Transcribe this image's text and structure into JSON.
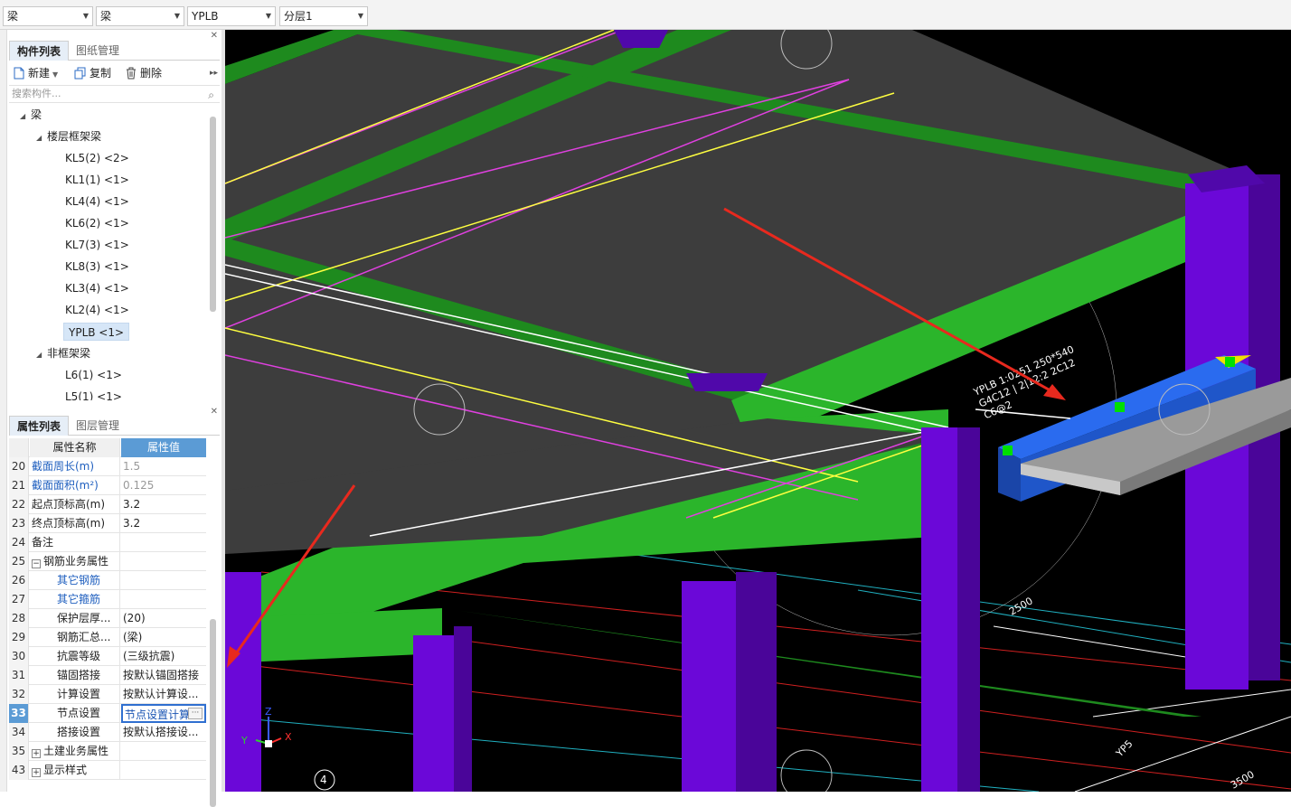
{
  "toolbar_combos": [
    {
      "value": "梁"
    },
    {
      "value": "梁"
    },
    {
      "value": "YPLB"
    },
    {
      "value": "分层1"
    }
  ],
  "component_panel": {
    "tabs": [
      "构件列表",
      "图纸管理"
    ],
    "actions": {
      "new": "新建",
      "copy": "复制",
      "delete": "删除"
    },
    "search_placeholder": "搜索构件...",
    "tree": {
      "root": "梁",
      "group1": "楼层框架梁",
      "items": [
        "KL5(2) <2>",
        "KL1(1) <1>",
        "KL4(4) <1>",
        "KL6(2) <1>",
        "KL7(3) <1>",
        "KL8(3) <1>",
        "KL3(4) <1>",
        "KL2(4) <1>",
        "YPLB <1>"
      ],
      "group2": "非框架梁",
      "items2": [
        "L6(1) <1>",
        "L5(1) <1>"
      ]
    }
  },
  "property_panel": {
    "tabs": [
      "属性列表",
      "图层管理"
    ],
    "header": {
      "name": "属性名称",
      "value": "属性值"
    },
    "rows": [
      {
        "num": "20",
        "name": "截面周长(m)",
        "value": "1.5"
      },
      {
        "num": "21",
        "name": "截面面积(m²)",
        "value": "0.125"
      },
      {
        "num": "22",
        "name": "起点顶标高(m)",
        "value": "3.2"
      },
      {
        "num": "23",
        "name": "终点顶标高(m)",
        "value": "3.2"
      },
      {
        "num": "24",
        "name": "备注",
        "value": ""
      },
      {
        "num": "25",
        "name": "钢筋业务属性",
        "value": ""
      },
      {
        "num": "26",
        "name": "其它钢筋",
        "value": ""
      },
      {
        "num": "27",
        "name": "其它箍筋",
        "value": ""
      },
      {
        "num": "28",
        "name": "保护层厚...",
        "value": "(20)"
      },
      {
        "num": "29",
        "name": "钢筋汇总...",
        "value": "(梁)"
      },
      {
        "num": "30",
        "name": "抗震等级",
        "value": "(三级抗震)"
      },
      {
        "num": "31",
        "name": "锚固搭接",
        "value": "按默认锚固搭接"
      },
      {
        "num": "32",
        "name": "计算设置",
        "value": "按默认计算设..."
      },
      {
        "num": "33",
        "name": "节点设置",
        "value": "节点设置计算"
      },
      {
        "num": "34",
        "name": "搭接设置",
        "value": "按默认搭接设..."
      },
      {
        "num": "35",
        "name": "土建业务属性",
        "value": ""
      },
      {
        "num": "43",
        "name": "显示样式",
        "value": ""
      }
    ]
  },
  "viewport": {
    "annotation_lines": [
      "YPLB 1:0251 250*540",
      "G4C12 | 2|12:2 2C12",
      "C6@2"
    ],
    "dimension_labels": [
      "2500",
      "3500",
      "YP5"
    ],
    "axis_labels": {
      "x": "X",
      "y": "Y",
      "z": "Z"
    },
    "grid_number": "4"
  },
  "colors": {
    "beam_green": "#2bb52b",
    "column_purple": "#6b08d8",
    "selected_beam_blue": "#1f56c9",
    "slab_gray": "#3d3d3d",
    "arrow_red": "#e8291e"
  }
}
